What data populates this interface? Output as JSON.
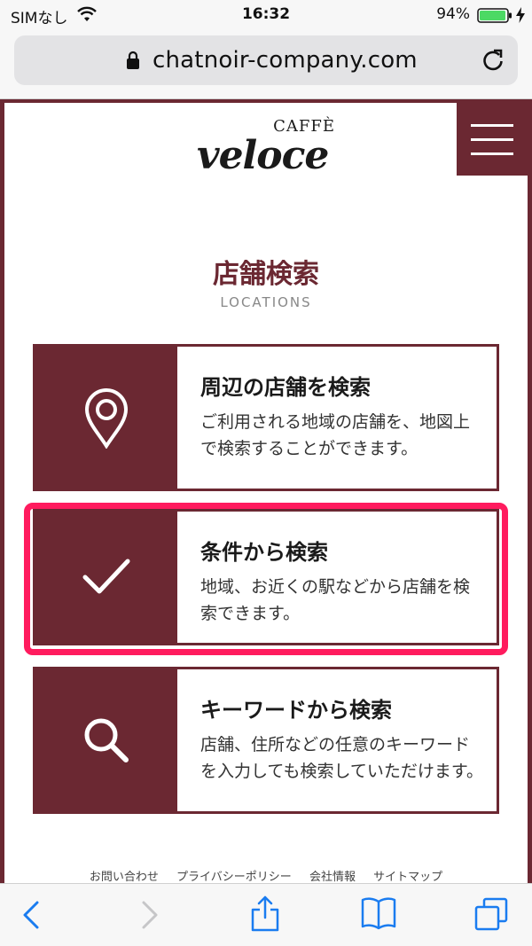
{
  "status_bar": {
    "carrier": "SIMなし",
    "time": "16:32",
    "battery": "94%"
  },
  "browser": {
    "url": "chatnoir-company.com"
  },
  "brand": {
    "logo_small": "CAFFÈ",
    "logo_main": "veloce"
  },
  "section": {
    "title": "店舗検索",
    "subtitle": "LOCATIONS"
  },
  "cards": [
    {
      "icon": "location-pin-icon",
      "title": "周辺の店舗を検索",
      "desc": "ご利用される地域の店舗を、地図上で検索することができます。"
    },
    {
      "icon": "checkmark-icon",
      "title": "条件から検索",
      "desc": "地域、お近くの駅などから店舗を検索できます。"
    },
    {
      "icon": "search-icon",
      "title": "キーワードから検索",
      "desc": "店舗、住所などの任意のキーワードを入力しても検索していただけます。"
    }
  ],
  "footer": {
    "links": [
      "お問い合わせ",
      "プライバシーポリシー",
      "会社情報",
      "サイトマップ"
    ]
  },
  "colors": {
    "brand": "#6b2832",
    "highlight": "#ff1b5e"
  }
}
